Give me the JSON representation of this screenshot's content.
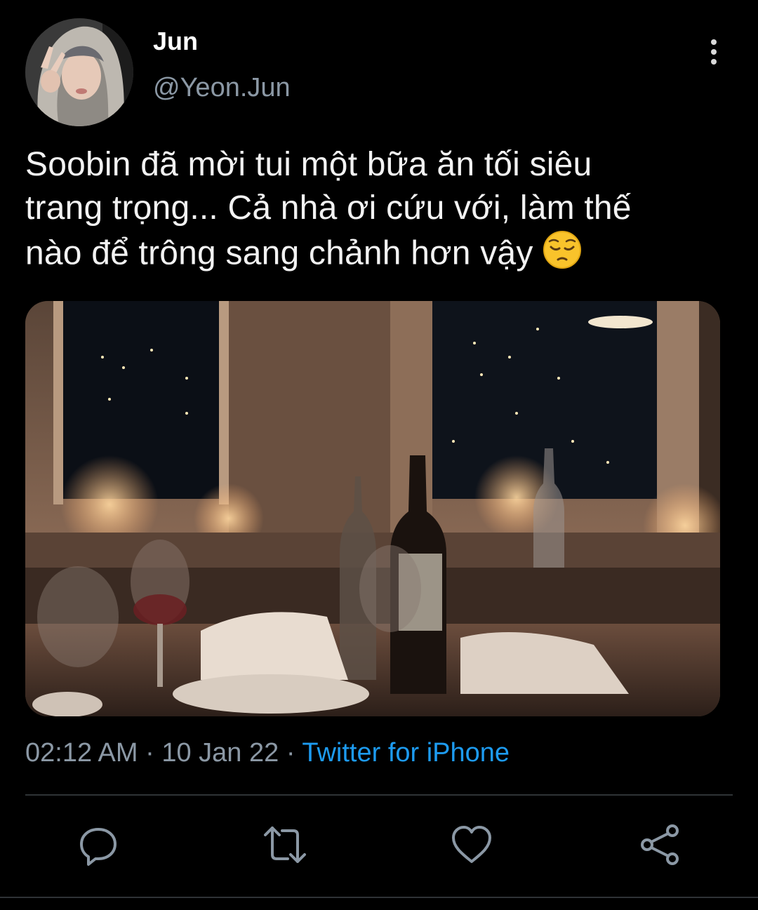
{
  "user": {
    "name": "Jun",
    "handle": "@Yeon.Jun",
    "avatar_icon": "profile-photo"
  },
  "tweet": {
    "lines": [
      "Soobin đã mời tui một bữa ăn tối siêu",
      "trang trọng... Cả nhà ơi cứu với, làm thế",
      "nào để trông sang chảnh hơn vậy"
    ],
    "emoji": "pensive-face"
  },
  "media": {
    "alt_icon": "restaurant-dinner-photo"
  },
  "meta": {
    "time": "02:12 AM",
    "sep1": " · ",
    "date": "10 Jan 22",
    "sep2": " · ",
    "source": "Twitter for iPhone"
  },
  "actions": {
    "reply": "reply-icon",
    "retweet": "retweet-icon",
    "like": "heart-icon",
    "share": "share-icon"
  },
  "colors": {
    "background": "#000000",
    "secondary_text": "#8b98a5",
    "link": "#1d9bf0",
    "divider": "#2f3336"
  }
}
